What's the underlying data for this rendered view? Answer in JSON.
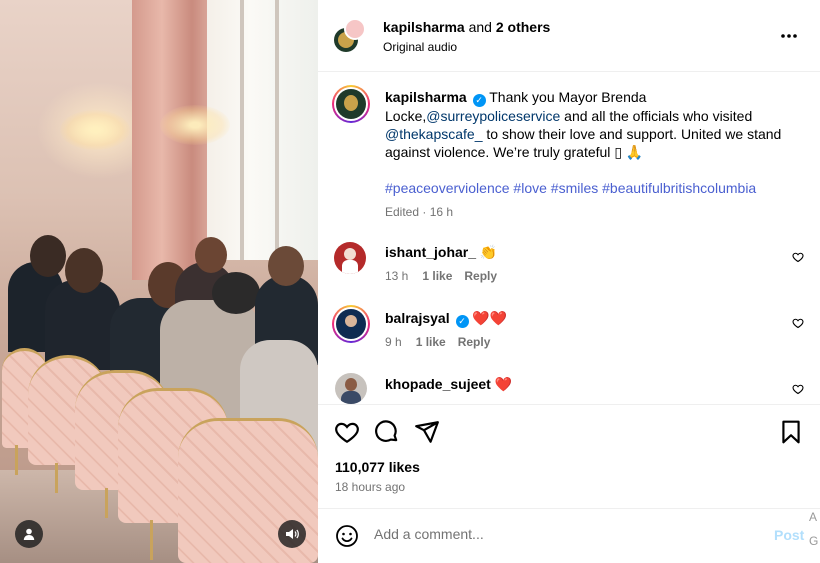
{
  "post": {
    "header": {
      "author": "kapilsharma",
      "and": " and ",
      "others": "2 others",
      "audio": "Original audio",
      "more_icon": "more-horizontal-icon"
    },
    "caption": {
      "username": "kapilsharma",
      "text_1": "Thank you Mayor Brenda Locke,",
      "mention_1": "@surreypoliceservice",
      "text_2": " and all the officials who visited ",
      "mention_2": "@thekapscafe_",
      "text_3": " to show their love and support. United we stand against violence. We’re truly grateful ",
      "emoji_box": "▯",
      "emoji": "🙏",
      "hashtags": "#peaceoverviolence #love #smiles #beautifulbritishcolumbia",
      "edited": "Edited · 16 h"
    },
    "comments": [
      {
        "user": "ishant_johar_",
        "emoji": "👏",
        "time": "13 h",
        "likes": "1 like",
        "reply": "Reply"
      },
      {
        "user": "balrajsyal",
        "emoji": "❤️❤️",
        "time": "9 h",
        "likes": "1 like",
        "reply": "Reply"
      },
      {
        "user": "khopade_sujeet",
        "emoji": "❤️"
      }
    ],
    "likes": "110,077 likes",
    "posted": "18 hours ago",
    "comment_box": {
      "placeholder": "Add a comment...",
      "post_label": "Post"
    }
  },
  "edge_text": {
    "a": "A",
    "g": "G"
  },
  "colors": {
    "accent": "#0095f6",
    "hashtag": "#4a5fd0",
    "link": "#00376b",
    "muted": "#737373"
  }
}
